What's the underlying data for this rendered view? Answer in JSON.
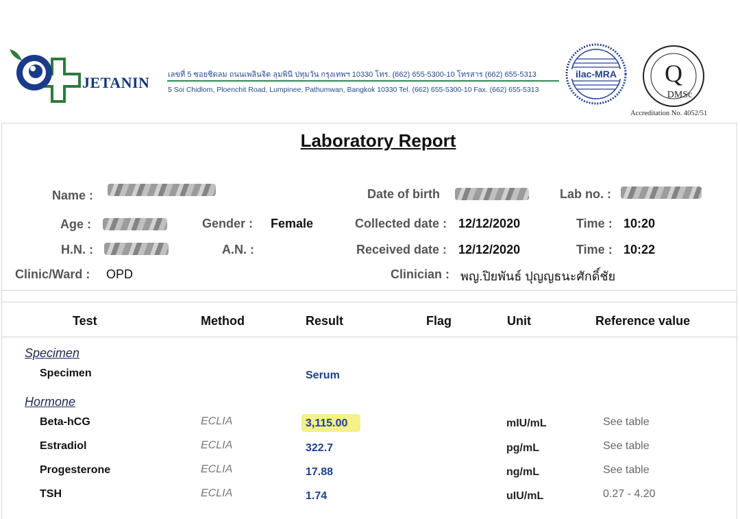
{
  "header": {
    "brand": "JETANIN",
    "address_th": "เลขที่ 5 ซอยชิดลม ถนนเพลินจิต ลุมพินี ปทุมวัน กรุงเทพฯ 10330 โทร. (662) 655-5300-10 โทรสาร (662) 655-5313",
    "address_en": "5 Soi Chidlom, Ploenchit Road, Lumpinee, Pathumwan, Bangkok 10330 Tel. (662) 655-5300-10 Fax. (662) 655-5313",
    "ilac_logo_text": "ilac-MRA",
    "dms_logo_text": "DMSc",
    "accreditation": "Accreditation No. 4052/51"
  },
  "report": {
    "title": "Laboratory Report"
  },
  "patient": {
    "name_label": "Name :",
    "dob_label": "Date of birth",
    "labno_label": "Lab no. :",
    "age_label": "Age :",
    "gender_label": "Gender :",
    "gender_value": "Female",
    "collected_label": "Collected date :",
    "collected_value": "12/12/2020",
    "time1_label": "Time :",
    "time1_value": "10:20",
    "hn_label": "H.N. :",
    "an_label": "A.N. :",
    "received_label": "Received date :",
    "received_value": "12/12/2020",
    "time2_label": "Time :",
    "time2_value": "10:22",
    "clinic_label": "Clinic/Ward :",
    "clinic_value": "OPD",
    "clinician_label": "Clinician :",
    "clinician_value": "พญ.ปิยพันธ์ ปุญญธนะศักดิ์ชัย"
  },
  "table": {
    "headers": {
      "test": "Test",
      "method": "Method",
      "result": "Result",
      "flag": "Flag",
      "unit": "Unit",
      "reference": "Reference value"
    },
    "sections": [
      {
        "name": "Specimen",
        "rows": [
          {
            "test": "Specimen",
            "method": "",
            "result": "Serum",
            "unit": "",
            "reference": ""
          }
        ]
      },
      {
        "name": "Hormone",
        "rows": [
          {
            "test": "Beta-hCG",
            "method": "ECLIA",
            "result": "3,115.00",
            "unit": "mIU/mL",
            "reference": "See table"
          },
          {
            "test": "Estradiol",
            "method": "ECLIA",
            "result": "322.7",
            "unit": "pg/mL",
            "reference": "See table"
          },
          {
            "test": "Progesterone",
            "method": "ECLIA",
            "result": "17.88",
            "unit": "ng/mL",
            "reference": "See table"
          },
          {
            "test": "TSH",
            "method": "ECLIA",
            "result": "1.74",
            "unit": "uIU/mL",
            "reference": "0.27 - 4.20"
          }
        ]
      }
    ]
  },
  "colors": {
    "brand_blue": "#123a78",
    "result_blue": "#1b3f8f",
    "highlight": "#f3f188",
    "label_gray": "#555555"
  }
}
